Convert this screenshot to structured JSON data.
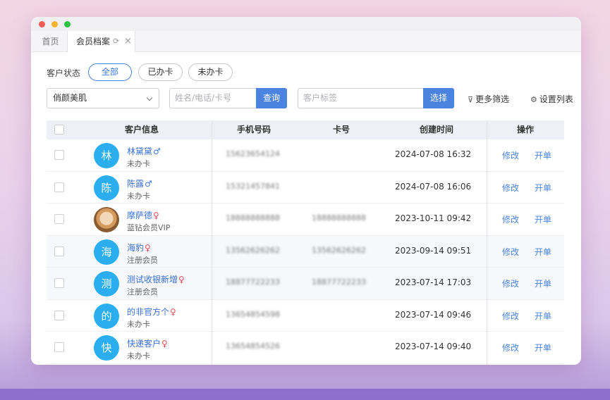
{
  "tabs": {
    "home": "首页",
    "active": "会员档案",
    "refresh_icon": "refresh-icon",
    "close_icon": "close-icon"
  },
  "filters": {
    "status_label": "客户状态",
    "status_options": [
      "全部",
      "已办卡",
      "未办卡"
    ],
    "status_selected": "全部",
    "store_value": "俏颜美肌",
    "name_placeholder": "姓名/电话/卡号",
    "query_label": "查询",
    "tag_placeholder": "客户标签",
    "choose_label": "选择",
    "more_filter_label": "更多筛选",
    "settings_label": "设置列表"
  },
  "table": {
    "headers": {
      "info": "客户信息",
      "phone": "手机号码",
      "card": "卡号",
      "created": "创建时间",
      "ops": "操作"
    },
    "rows": [
      {
        "avatar": "林",
        "name": "林黛黛",
        "gender": "♂",
        "sub": "未办卡",
        "phone": "15623654124",
        "card": "",
        "created": "2024-07-08 16:32",
        "edit": "修改",
        "bill": "开单"
      },
      {
        "avatar": "陈",
        "name": "陈露",
        "gender": "♂",
        "sub": "未办卡",
        "phone": "15321457841",
        "card": "",
        "created": "2024-07-08 16:06",
        "edit": "修改",
        "bill": "开单"
      },
      {
        "avatar": "",
        "name": "摩萨德",
        "gender": "♀",
        "sub": "蓝钻会员VIP",
        "phone": "18888888888",
        "card": "18888888888",
        "created": "2023-10-11 09:42",
        "edit": "修改",
        "bill": "开单"
      },
      {
        "avatar": "海",
        "name": "海豹",
        "gender": "♀",
        "sub": "注册会员",
        "phone": "13562626262",
        "card": "13562626262",
        "created": "2023-09-14 09:51",
        "edit": "修改",
        "bill": "开单"
      },
      {
        "avatar": "测",
        "name": "测试收银新增",
        "gender": "♀",
        "sub": "注册会员",
        "phone": "18877722233",
        "card": "18877722233",
        "created": "2023-07-14 17:03",
        "edit": "修改",
        "bill": "开单"
      },
      {
        "avatar": "的",
        "name": "的非官方个",
        "gender": "♀",
        "sub": "未办卡",
        "phone": "13654854598",
        "card": "",
        "created": "2023-07-14 09:46",
        "edit": "修改",
        "bill": "开单"
      },
      {
        "avatar": "快",
        "name": "快递客户",
        "gender": "♀",
        "sub": "未办卡",
        "phone": "13654854526",
        "card": "",
        "created": "2023-07-14 09:40",
        "edit": "修改",
        "bill": "开单"
      }
    ]
  },
  "colors": {
    "accent": "#4a84e0",
    "avatar": "#2aaef0",
    "male": "#3a78e0",
    "female": "#e54d5a"
  }
}
